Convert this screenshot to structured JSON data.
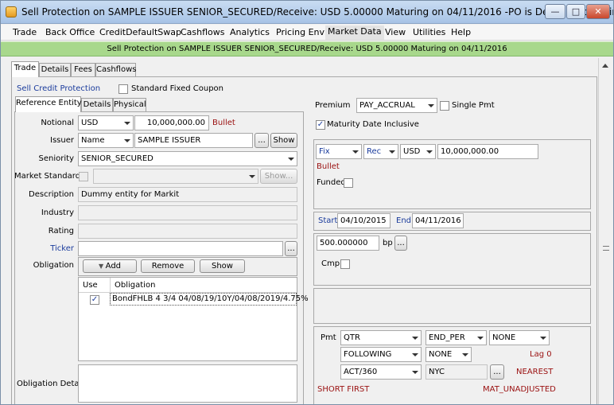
{
  "window": {
    "title": "Sell Protection on SAMPLE ISSUER SENIOR_SECURED/Receive: USD 5.00000 Maturing on 04/11/2016  -PO is Default Processing Org...",
    "minimize": "—",
    "maximize": "□",
    "close": "✕"
  },
  "menu": [
    "Trade",
    "Back Office",
    "CreditDefaultSwap",
    "Cashflows",
    "Analytics",
    "Pricing Env",
    "Market Data",
    "View",
    "Utilities",
    "Help"
  ],
  "banner": "Sell Protection on SAMPLE ISSUER SENIOR_SECURED/Receive: USD 5.00000 Maturing on 04/11/2016",
  "main_tabs": [
    "Trade",
    "Details",
    "Fees",
    "Cashflows"
  ],
  "trade": {
    "sell_credit_protection": "Sell Credit Protection",
    "standard_fixed_coupon": "Standard Fixed Coupon",
    "sub_tabs": [
      "Reference Entity",
      "Details",
      "Physical"
    ],
    "notional_label": "Notional",
    "notional_currency": "USD",
    "notional_amount": "10,000,000.00",
    "bullet": "Bullet",
    "issuer_label": "Issuer",
    "issuer_type": "Name",
    "issuer_value": "SAMPLE ISSUER",
    "ellipsis": "...",
    "show": "Show",
    "seniority_label": "Seniority",
    "seniority_value": "SENIOR_SECURED",
    "market_standard_label": "Market Standard",
    "market_standard_show": "Show...",
    "description_label": "Description",
    "description_value": "Dummy entity for Markit",
    "industry_label": "Industry",
    "rating_label": "Rating",
    "ticker_label": "Ticker",
    "obligation_label": "Obligation",
    "add": "Add",
    "remove": "Remove",
    "obligation_show": "Show",
    "obligation_columns": [
      "Use",
      "Obligation"
    ],
    "obligation_rows": [
      {
        "use": "✓",
        "obligation": "BondFHLB 4 3/4 04/08/19/10Y/04/08/2019/4.75%"
      }
    ],
    "obligation_detail_label": "Obligation Detail"
  },
  "premium": {
    "premium_label": "Premium",
    "premium_value": "PAY_ACCRUAL",
    "single_pmt": "Single Pmt",
    "maturity_date_inclusive": "Maturity Date Inclusive",
    "maturity_check": "✓",
    "fix": "Fix",
    "rec": "Rec",
    "currency": "USD",
    "amount": "10,000,000.00",
    "bullet": "Bullet",
    "funded": "Funded",
    "start_label": "Start",
    "start_date": "04/10/2015",
    "end_label": "End",
    "end_date": "04/11/2016",
    "rate": "500.000000",
    "rate_unit": "bp",
    "cmp": "Cmp",
    "pmt_label": "Pmt",
    "pmt_freq": "QTR",
    "end_per": "END_PER",
    "none1": "NONE",
    "following": "FOLLOWING",
    "none2": "NONE",
    "lag": "Lag 0",
    "daycount": "ACT/360",
    "holidays": "NYC",
    "nearest": "NEAREST",
    "short_first": "SHORT FIRST",
    "mat_unadjusted": "MAT_UNADJUSTED"
  },
  "colors": {
    "banner": "#a8d88c",
    "blue_label": "#1a3b9c",
    "red_label": "#9a1010"
  }
}
